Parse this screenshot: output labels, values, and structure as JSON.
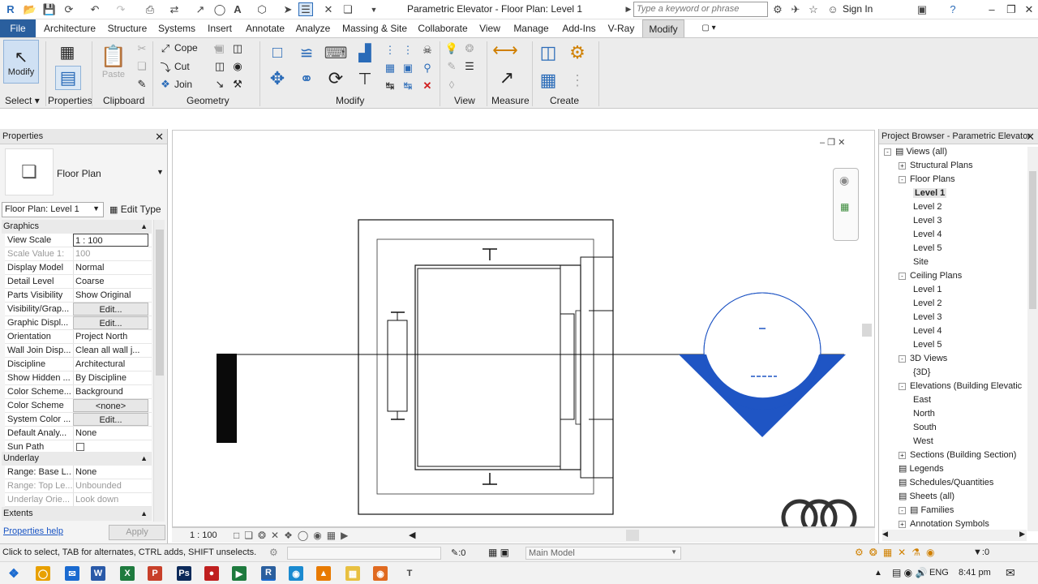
{
  "window": {
    "title": "Parametric Elevator - Floor Plan: Level 1",
    "search_placeholder": "Type a keyword or phrase",
    "sign_in": "Sign In"
  },
  "tabs": [
    "File",
    "Architecture",
    "Structure",
    "Systems",
    "Insert",
    "Annotate",
    "Analyze",
    "Massing & Site",
    "Collaborate",
    "View",
    "Manage",
    "Add-Ins",
    "V-Ray",
    "Modify"
  ],
  "ribbon": {
    "modify_label": "Modify",
    "paste_label": "Paste",
    "cope_label": "Cope",
    "cut_label": "Cut",
    "join_label": "Join",
    "groups": [
      "Select",
      "Properties",
      "Clipboard",
      "Geometry",
      "Modify",
      "View",
      "Measure",
      "Create"
    ]
  },
  "properties": {
    "title": "Properties",
    "type_name": "Floor Plan",
    "instance_selector": "Floor Plan: Level 1",
    "edit_type": "Edit Type",
    "sections": {
      "graphics": "Graphics",
      "underlay": "Underlay",
      "extents": "Extents"
    },
    "rows": [
      {
        "k": "View Scale",
        "v": "1 : 100"
      },
      {
        "k": "Scale Value    1:",
        "v": "100"
      },
      {
        "k": "Display Model",
        "v": "Normal"
      },
      {
        "k": "Detail Level",
        "v": "Coarse"
      },
      {
        "k": "Parts Visibility",
        "v": "Show Original"
      },
      {
        "k": "Visibility/Grap...",
        "v": "Edit..."
      },
      {
        "k": "Graphic Displ...",
        "v": "Edit..."
      },
      {
        "k": "Orientation",
        "v": "Project North"
      },
      {
        "k": "Wall Join Disp...",
        "v": "Clean all wall j..."
      },
      {
        "k": "Discipline",
        "v": "Architectural"
      },
      {
        "k": "Show Hidden ...",
        "v": "By Discipline"
      },
      {
        "k": "Color Scheme...",
        "v": "Background"
      },
      {
        "k": "Color Scheme",
        "v": "<none>"
      },
      {
        "k": "System Color ...",
        "v": "Edit..."
      },
      {
        "k": "Default Analy...",
        "v": "None"
      },
      {
        "k": "Sun Path",
        "v": ""
      }
    ],
    "underlay_rows": [
      {
        "k": "Range: Base L...",
        "v": "None"
      },
      {
        "k": "Range: Top Le...",
        "v": "Unbounded"
      },
      {
        "k": "Underlay Orie...",
        "v": "Look down"
      }
    ],
    "help_link": "Properties help",
    "apply": "Apply"
  },
  "view": {
    "scale": "1 : 100",
    "accent_color": "#1f55c4"
  },
  "browser": {
    "title": "Project Browser - Parametric Elevator",
    "nodes": [
      {
        "label": "Views (all)",
        "tog": "-"
      },
      {
        "label": "Structural Plans",
        "tog": "+"
      },
      {
        "label": "Floor Plans",
        "tog": "-"
      },
      {
        "label": "Level 1"
      },
      {
        "label": "Level 2"
      },
      {
        "label": "Level 3"
      },
      {
        "label": "Level 4"
      },
      {
        "label": "Level 5"
      },
      {
        "label": "Site"
      },
      {
        "label": "Ceiling Plans",
        "tog": "-"
      },
      {
        "label": "Level 1"
      },
      {
        "label": "Level 2"
      },
      {
        "label": "Level 3"
      },
      {
        "label": "Level 4"
      },
      {
        "label": "Level 5"
      },
      {
        "label": "3D Views",
        "tog": "-"
      },
      {
        "label": "{3D}"
      },
      {
        "label": "Elevations (Building Elevatic",
        "tog": "-"
      },
      {
        "label": "East"
      },
      {
        "label": "North"
      },
      {
        "label": "South"
      },
      {
        "label": "West"
      },
      {
        "label": "Sections (Building Section)",
        "tog": "+"
      },
      {
        "label": "Legends"
      },
      {
        "label": "Schedules/Quantities"
      },
      {
        "label": "Sheets (all)"
      },
      {
        "label": "Families",
        "tog": "-"
      },
      {
        "label": "Annotation Symbols",
        "tog": "+"
      }
    ]
  },
  "status": {
    "message": "Click to select, TAB for alternates, CTRL adds, SHIFT unselects.",
    "zero": ":0",
    "model": "Main Model",
    "filter": ":0"
  },
  "taskbar": {
    "lang": "ENG",
    "time": "8:41 pm"
  }
}
